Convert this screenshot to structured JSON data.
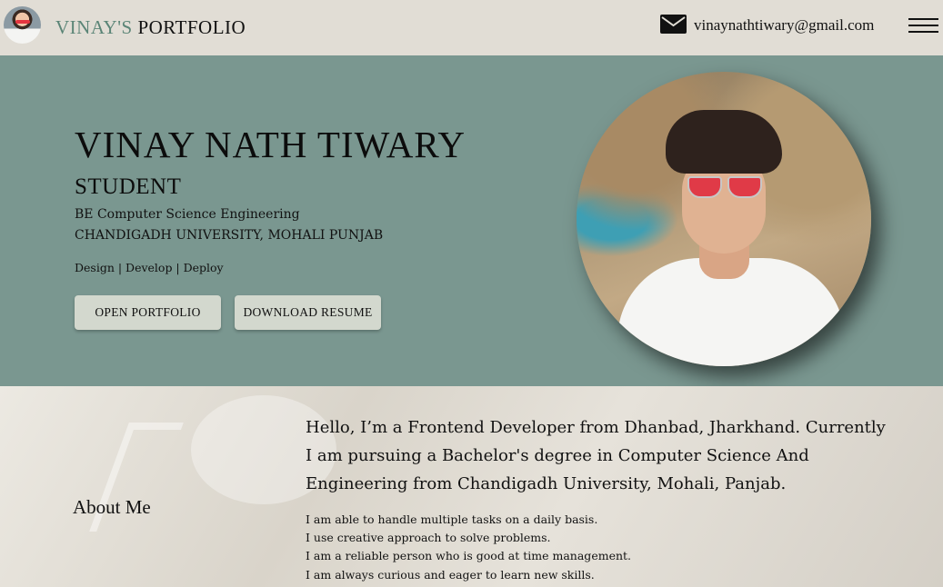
{
  "header": {
    "brand_part1": "VINAY'S",
    "brand_part2": "PORTFOLIO",
    "email": "vinaynathtiwary@gmail.com"
  },
  "hero": {
    "name": "VINAY NATH TIWARY",
    "role": "STUDENT",
    "degree": "BE Computer Science Engineering",
    "university": "CHANDIGADH UNIVERSITY, MOHALI PUNJAB",
    "tagline": "Design | Develop | Deploy",
    "open_portfolio_label": "OPEN PORTFOLIO",
    "download_resume_label": "DOWNLOAD RESUME"
  },
  "about": {
    "title": "About Me",
    "intro": "Hello, I’m a Frontend Developer from Dhanbad, Jharkhand. Currently I am pursuing a Bachelor's degree in Computer Science And Engineering from Chandigadh University, Mohali, Panjab.",
    "lines": [
      "I am able to handle multiple tasks on a daily basis.",
      "I use creative approach to solve problems.",
      "I am a reliable person who is good at time management.",
      "I am always curious and eager to learn new skills."
    ]
  },
  "colors": {
    "header_bg": "#e1ddd5",
    "hero_bg": "#7a9790",
    "brand_accent": "#5b8577",
    "button_bg": "#d3d8ce"
  },
  "icons": [
    "mail-icon",
    "menu-icon"
  ]
}
